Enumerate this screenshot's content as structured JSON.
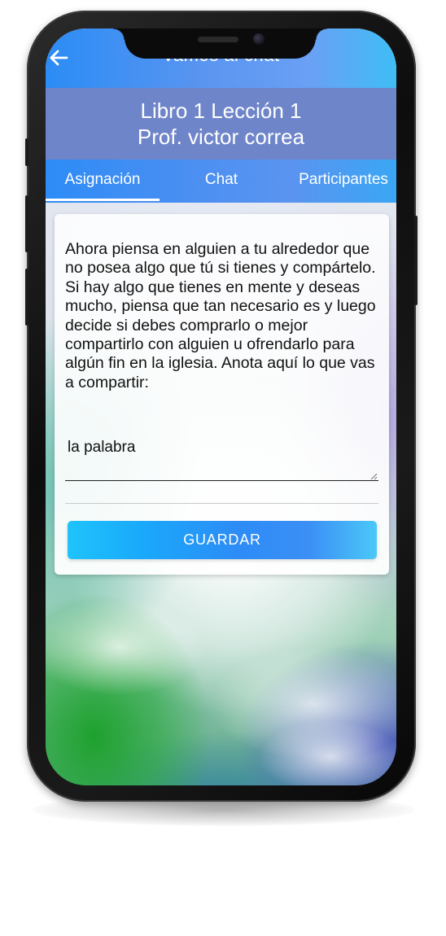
{
  "app_bar": {
    "title": "Vamos al chat",
    "back_icon": "arrow-left-icon"
  },
  "header": {
    "line1": "Libro 1 Lección 1",
    "line2": "Prof. victor correa"
  },
  "tabs": [
    {
      "label": "Asignación",
      "active": true
    },
    {
      "label": "Chat",
      "active": false
    },
    {
      "label": "Participantes",
      "active": false
    }
  ],
  "assignment": {
    "prompt": "Ahora piensa en alguien a tu alrededor que no posea algo que tú si tienes y compártelo. Si hay algo que tienes en mente y deseas mucho, piensa que tan necesario es y luego decide si debes comprarlo o mejor compartirlo con alguien u ofrendarlo para algún fin en la iglesia. Anota aquí lo que vas a compartir:",
    "answer_value": "la palabra",
    "save_label": "GUARDAR"
  },
  "colors": {
    "app_bar": "#5a95f0",
    "header_band": "#6f85c9",
    "tabs": "#4a8ff2",
    "button_start": "#1fc3fb",
    "button_mid": "#2d8cf6"
  }
}
